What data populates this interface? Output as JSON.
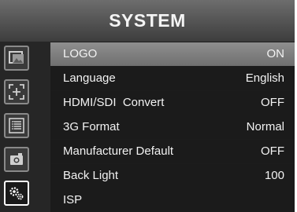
{
  "header": {
    "title": "SYSTEM"
  },
  "sidebar": {
    "items": [
      {
        "icon": "picture-icon",
        "active": false
      },
      {
        "icon": "marker-frame-icon",
        "active": false
      },
      {
        "icon": "list-icon",
        "active": false
      },
      {
        "icon": "camera-icon",
        "active": false
      },
      {
        "icon": "system-gears-icon",
        "active": true
      }
    ]
  },
  "menu": {
    "items": [
      {
        "label": "LOGO",
        "value": "ON",
        "selected": true
      },
      {
        "label": "Language",
        "value": "English"
      },
      {
        "label": "HDMI/SDI  Convert",
        "value": "OFF"
      },
      {
        "label": "3G Format",
        "value": "Normal"
      },
      {
        "label": "Manufacturer Default",
        "value": "OFF"
      },
      {
        "label": "Back Light",
        "value": "100"
      },
      {
        "label": "ISP",
        "value": ""
      }
    ]
  },
  "colors": {
    "selected_row": "#7f7f7f",
    "background": "#1c1c1c",
    "text": "#f2f2f2"
  }
}
